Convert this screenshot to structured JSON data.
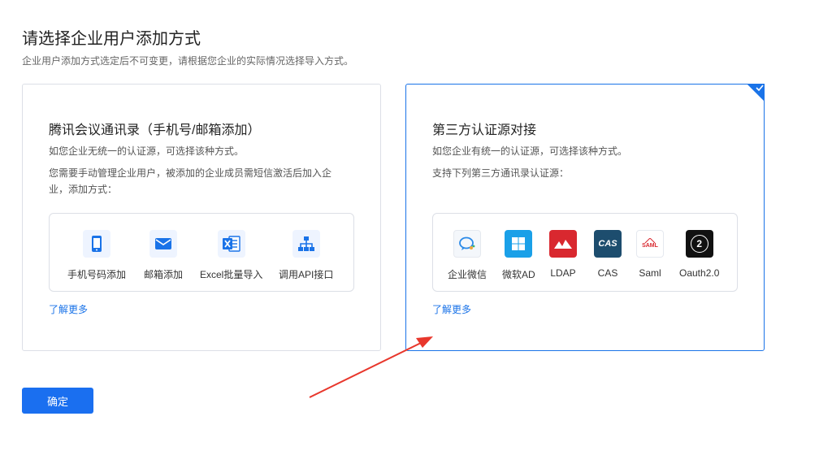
{
  "header": {
    "title": "请选择企业用户添加方式",
    "subtitle": "企业用户添加方式选定后不可变更，请根据您企业的实际情况选择导入方式。"
  },
  "left_card": {
    "title": "腾讯会议通讯录（手机号/邮箱添加）",
    "desc1": "如您企业无统一的认证源，可选择该种方式。",
    "desc2": "您需要手动管理企业用户，被添加的企业成员需短信激活后加入企业，添加方式：",
    "options": [
      {
        "label": "手机号码添加",
        "icon": "phone-icon"
      },
      {
        "label": "邮箱添加",
        "icon": "mail-icon"
      },
      {
        "label": "Excel批量导入",
        "icon": "excel-icon"
      },
      {
        "label": "调用API接口",
        "icon": "api-icon"
      }
    ],
    "learn_more": "了解更多"
  },
  "right_card": {
    "title": "第三方认证源对接",
    "desc1": "如您企业有统一的认证源，可选择该种方式。",
    "desc2": "支持下列第三方通讯录认证源：",
    "options": [
      {
        "label": "企业微信",
        "icon": "wecom-icon"
      },
      {
        "label": "微软AD",
        "icon": "windows-icon"
      },
      {
        "label": "LDAP",
        "icon": "ldap-icon"
      },
      {
        "label": "CAS",
        "icon": "cas-icon",
        "text": "CAS"
      },
      {
        "label": "Saml",
        "icon": "saml-icon",
        "text": "SAML"
      },
      {
        "label": "Oauth2.0",
        "icon": "oauth-icon",
        "text": "2"
      }
    ],
    "learn_more": "了解更多",
    "selected": true
  },
  "footer": {
    "confirm_label": "确定"
  },
  "colors": {
    "primary": "#1a73e8",
    "button": "#1a6ff0",
    "arrow": "#e8372c",
    "ldap": "#d9282f",
    "cas": "#1d4d6e",
    "windows": "#1aa0e8",
    "oauth": "#111111"
  }
}
